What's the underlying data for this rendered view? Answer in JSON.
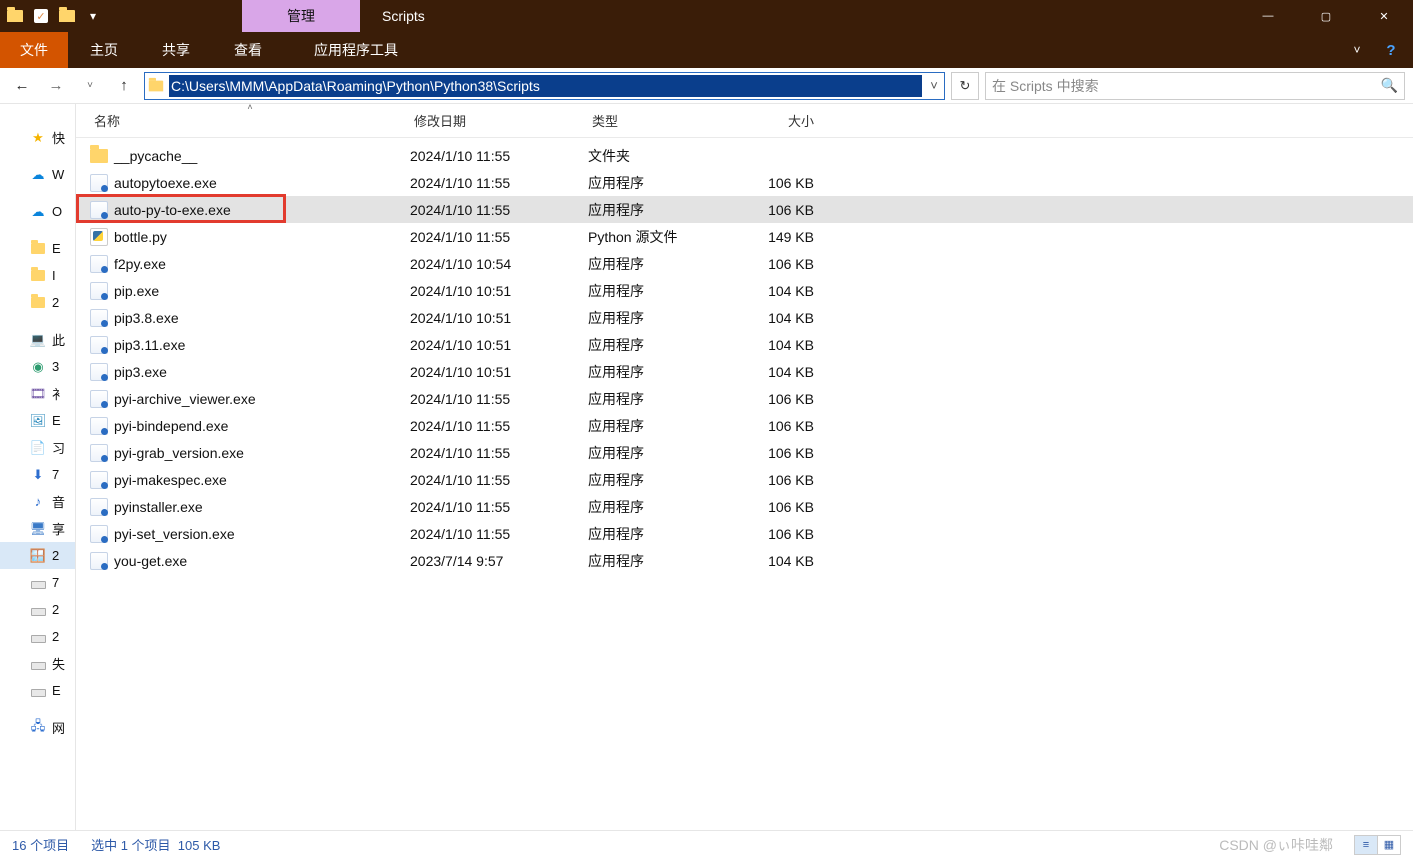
{
  "titlebar": {
    "context_tab": "管理",
    "window_title": "Scripts"
  },
  "ribbon": {
    "file": "文件",
    "home": "主页",
    "share": "共享",
    "view": "查看",
    "app_tools": "应用程序工具"
  },
  "nav": {
    "address": "C:\\Users\\MMM\\AppData\\Roaming\\Python\\Python38\\Scripts",
    "search_placeholder": "在 Scripts 中搜索"
  },
  "columns": {
    "name": "名称",
    "date": "修改日期",
    "type": "类型",
    "size": "大小"
  },
  "sidebar": [
    {
      "icon": "star",
      "label": "快"
    },
    {
      "icon": "cloud",
      "label": "W"
    },
    {
      "icon": "cloud",
      "label": "O"
    },
    {
      "icon": "folder",
      "label": "E"
    },
    {
      "icon": "folder",
      "label": "I"
    },
    {
      "icon": "folder",
      "label": "2"
    },
    {
      "icon": "pc",
      "label": "此"
    },
    {
      "icon": "cube",
      "label": "3"
    },
    {
      "icon": "video",
      "label": "衤"
    },
    {
      "icon": "image",
      "label": "E"
    },
    {
      "icon": "doc",
      "label": "习"
    },
    {
      "icon": "down",
      "label": "7"
    },
    {
      "icon": "music",
      "label": "音"
    },
    {
      "icon": "desk",
      "label": "享"
    },
    {
      "icon": "osdrv",
      "label": "2",
      "selected": true
    },
    {
      "icon": "drive",
      "label": "7"
    },
    {
      "icon": "drive",
      "label": "2"
    },
    {
      "icon": "drive",
      "label": "2"
    },
    {
      "icon": "drive",
      "label": "失"
    },
    {
      "icon": "drive",
      "label": "E"
    },
    {
      "icon": "net",
      "label": "网"
    }
  ],
  "files": [
    {
      "icon": "folder",
      "name": "__pycache__",
      "date": "2024/1/10 11:55",
      "type": "文件夹",
      "size": ""
    },
    {
      "icon": "exe",
      "name": "autopytoexe.exe",
      "date": "2024/1/10 11:55",
      "type": "应用程序",
      "size": "106 KB"
    },
    {
      "icon": "exe",
      "name": "auto-py-to-exe.exe",
      "date": "2024/1/10 11:55",
      "type": "应用程序",
      "size": "106 KB",
      "selected": true,
      "highlight": true
    },
    {
      "icon": "py",
      "name": "bottle.py",
      "date": "2024/1/10 11:55",
      "type": "Python 源文件",
      "size": "149 KB"
    },
    {
      "icon": "exe",
      "name": "f2py.exe",
      "date": "2024/1/10 10:54",
      "type": "应用程序",
      "size": "106 KB"
    },
    {
      "icon": "exe",
      "name": "pip.exe",
      "date": "2024/1/10 10:51",
      "type": "应用程序",
      "size": "104 KB"
    },
    {
      "icon": "exe",
      "name": "pip3.8.exe",
      "date": "2024/1/10 10:51",
      "type": "应用程序",
      "size": "104 KB"
    },
    {
      "icon": "exe",
      "name": "pip3.11.exe",
      "date": "2024/1/10 10:51",
      "type": "应用程序",
      "size": "104 KB"
    },
    {
      "icon": "exe",
      "name": "pip3.exe",
      "date": "2024/1/10 10:51",
      "type": "应用程序",
      "size": "104 KB"
    },
    {
      "icon": "exe",
      "name": "pyi-archive_viewer.exe",
      "date": "2024/1/10 11:55",
      "type": "应用程序",
      "size": "106 KB"
    },
    {
      "icon": "exe",
      "name": "pyi-bindepend.exe",
      "date": "2024/1/10 11:55",
      "type": "应用程序",
      "size": "106 KB"
    },
    {
      "icon": "exe",
      "name": "pyi-grab_version.exe",
      "date": "2024/1/10 11:55",
      "type": "应用程序",
      "size": "106 KB"
    },
    {
      "icon": "exe",
      "name": "pyi-makespec.exe",
      "date": "2024/1/10 11:55",
      "type": "应用程序",
      "size": "106 KB"
    },
    {
      "icon": "exe",
      "name": "pyinstaller.exe",
      "date": "2024/1/10 11:55",
      "type": "应用程序",
      "size": "106 KB"
    },
    {
      "icon": "exe",
      "name": "pyi-set_version.exe",
      "date": "2024/1/10 11:55",
      "type": "应用程序",
      "size": "106 KB"
    },
    {
      "icon": "exe",
      "name": "you-get.exe",
      "date": "2023/7/14 9:57",
      "type": "应用程序",
      "size": "104 KB"
    }
  ],
  "status": {
    "count": "16 个项目",
    "selected": "选中 1 个项目",
    "sel_size": "105 KB",
    "watermark": "CSDN @ぃ咔哇鄰"
  }
}
